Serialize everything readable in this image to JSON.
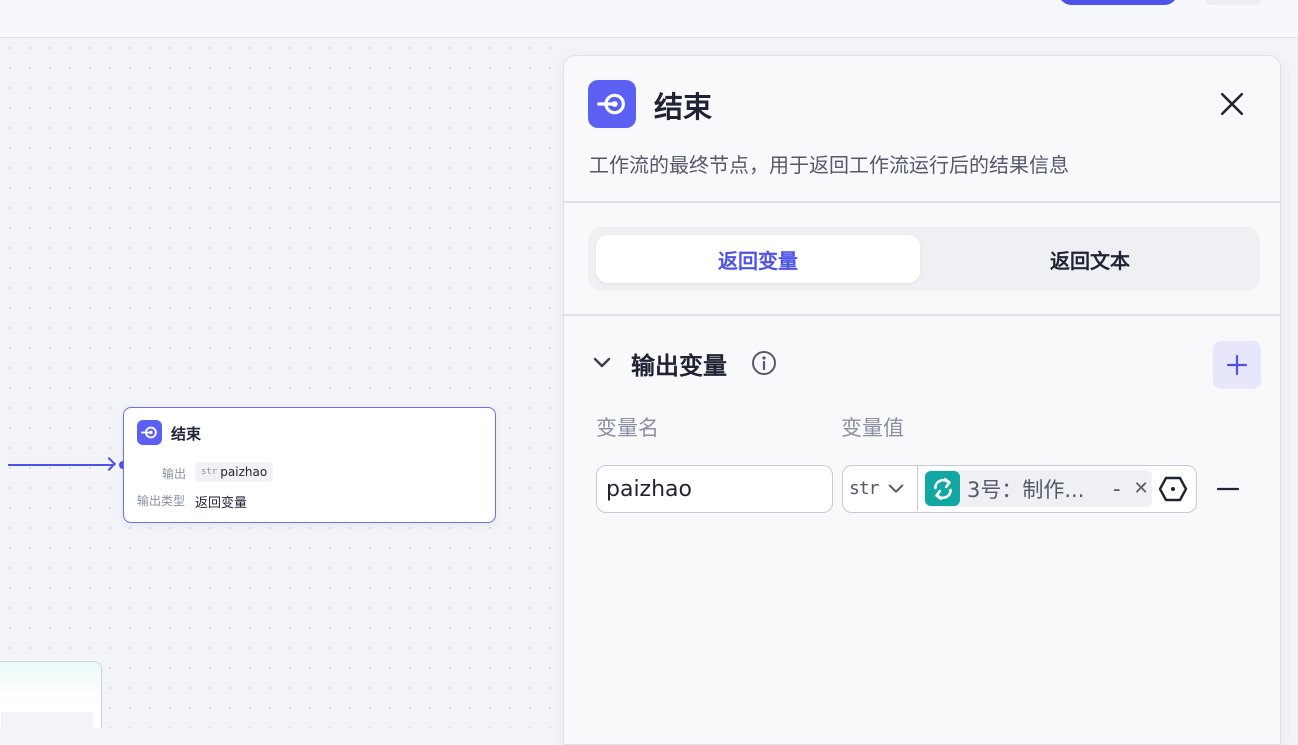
{
  "colors": {
    "accent": "#4d53e8",
    "node_icon": "#5c60f2",
    "ref_icon": "#13a7a3"
  },
  "canvas": {
    "node": {
      "icon": "end-node-icon",
      "title": "结束",
      "output_label": "输出",
      "output_type_tag": "str",
      "output_var": "paizhao",
      "output_type_label": "输出类型",
      "output_type_value": "返回变量"
    }
  },
  "panel": {
    "icon": "end-node-icon",
    "title": "结束",
    "description": "工作流的最终节点，用于返回工作流运行后的结果信息",
    "tabs": [
      {
        "label": "返回变量",
        "active": true
      },
      {
        "label": "返回文本",
        "active": false
      }
    ],
    "section": {
      "title": "输出变量",
      "columns": {
        "name": "变量名",
        "value": "变量值"
      },
      "rows": [
        {
          "name": "paizhao",
          "type": "str",
          "ref_icon": "loop-icon",
          "ref_text": "3号：制作...",
          "ref_suffix": "-"
        }
      ]
    }
  }
}
